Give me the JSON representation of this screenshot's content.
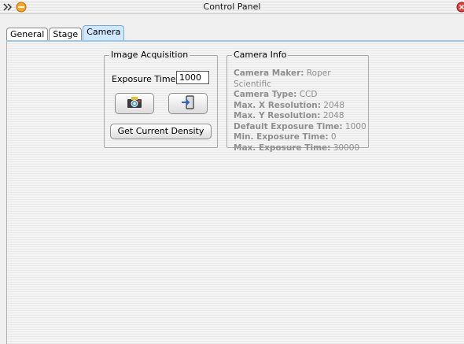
{
  "window": {
    "title": "Control Panel"
  },
  "tabs": [
    {
      "label": "General",
      "active": false
    },
    {
      "label": "Stage",
      "active": false
    },
    {
      "label": "Camera",
      "active": true
    }
  ],
  "acquisition": {
    "legend": "Image Acquisition",
    "exposure_label": "Exposure Time:",
    "exposure_value": "1000",
    "camera_icon": "camera-icon",
    "exit_icon": "exit-icon",
    "density_button": "Get Current Density"
  },
  "camera_info": {
    "legend": "Camera Info",
    "rows": [
      {
        "label": "Camera Maker:",
        "value": "Roper Scientific"
      },
      {
        "label": "Camera Type:",
        "value": "CCD"
      },
      {
        "label": "Max. X Resolution:",
        "value": "2048"
      },
      {
        "label": "Max. Y Resolution:",
        "value": "2048"
      },
      {
        "label": "Default Exposure Time:",
        "value": "1000"
      },
      {
        "label": "Min. Exposure Time:",
        "value": "0"
      },
      {
        "label": "Max. Exposure Time:",
        "value": "30000"
      }
    ]
  },
  "colors": {
    "tab_active": "#cfe8ff",
    "accent": "#9cc6ea",
    "info_text": "#8f8f8f"
  }
}
